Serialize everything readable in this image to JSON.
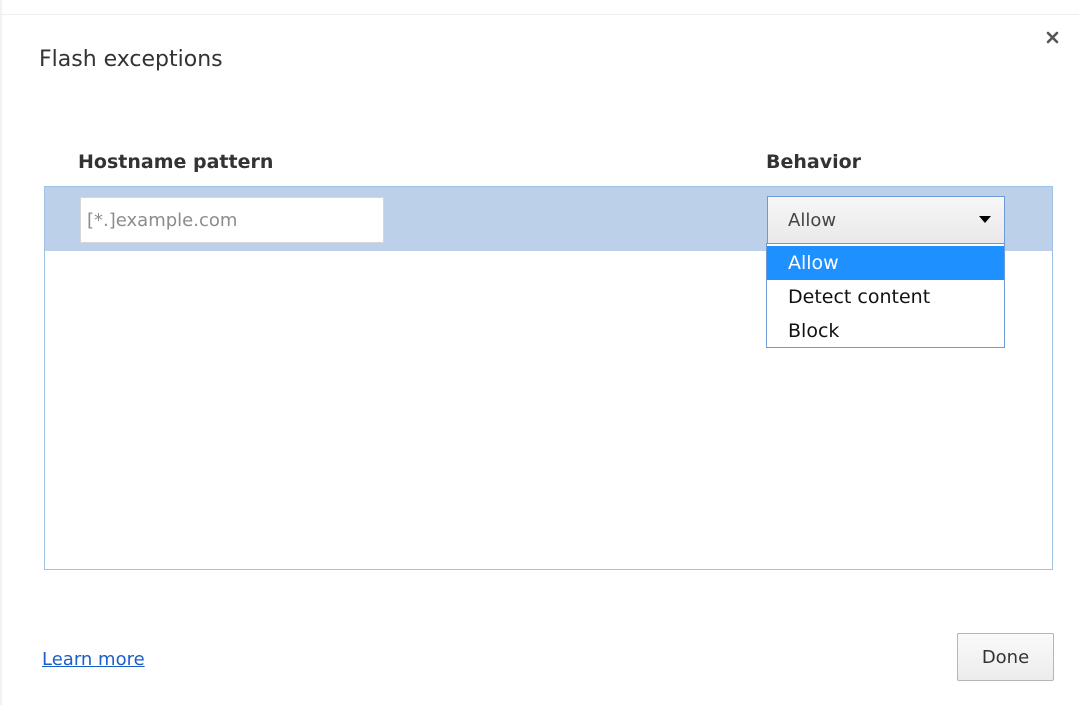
{
  "dialog": {
    "title": "Flash exceptions",
    "close_glyph": "×"
  },
  "columns": {
    "hostname": "Hostname pattern",
    "behavior": "Behavior"
  },
  "new_entry": {
    "hostname_placeholder": "[*.]example.com",
    "hostname_value": "",
    "behavior_selected": "Allow"
  },
  "behavior_options": [
    {
      "label": "Allow",
      "highlighted": true
    },
    {
      "label": "Detect content",
      "highlighted": false
    },
    {
      "label": "Block",
      "highlighted": false
    }
  ],
  "footer": {
    "learn_more": "Learn more",
    "done": "Done"
  },
  "colors": {
    "selected_row": "#bdd0ea",
    "dropdown_highlight": "#1e90ff",
    "link": "#1a5fc7"
  }
}
